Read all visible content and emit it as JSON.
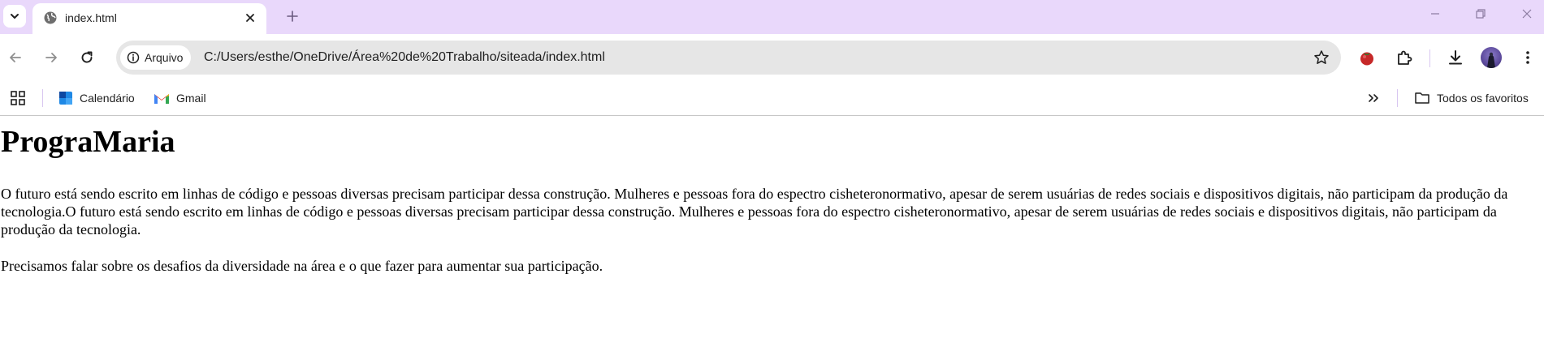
{
  "browser": {
    "tab": {
      "title": "index.html"
    },
    "omnibox": {
      "chip_label": "Arquivo",
      "url": "C:/Users/esthe/OneDrive/Área%20de%20Trabalho/siteada/index.html"
    },
    "bookmarks": {
      "items": [
        {
          "label": "Calendário",
          "icon": "calendar-icon"
        },
        {
          "label": "Gmail",
          "icon": "gmail-icon"
        }
      ],
      "all_bookmarks_label": "Todos os favoritos"
    },
    "colors": {
      "tabstrip_bg": "#e9d8fb",
      "omnibox_bg": "#e6e6e6"
    }
  },
  "page": {
    "heading": "PrograMaria",
    "paragraphs": [
      "O futuro está sendo escrito em linhas de código e pessoas diversas precisam participar dessa construção. Mulheres e pessoas fora do espectro cisheteronormativo, apesar de serem usuárias de redes sociais e dispositivos digitais, não participam da produção da tecnologia.O futuro está sendo escrito em linhas de código e pessoas diversas precisam participar dessa construção. Mulheres e pessoas fora do espectro cisheteronormativo, apesar de serem usuárias de redes sociais e dispositivos digitais, não participam da produção da tecnologia.",
      "Precisamos falar sobre os desafios da diversidade na área e o que fazer para aumentar sua participação."
    ]
  }
}
